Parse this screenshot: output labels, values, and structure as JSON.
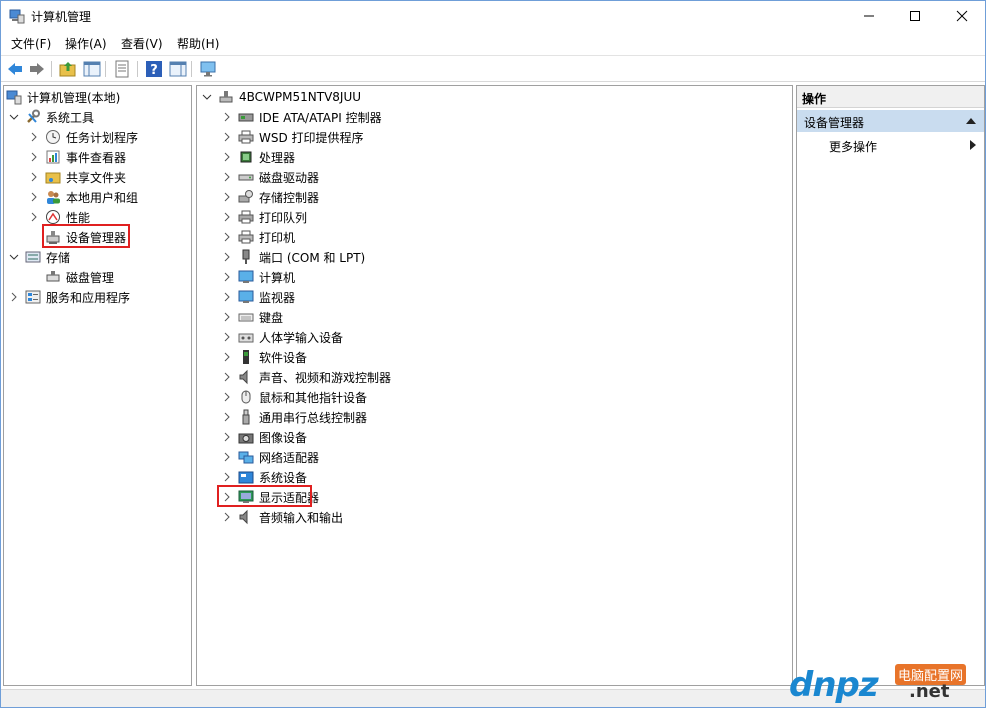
{
  "window": {
    "title": "计算机管理"
  },
  "menu": [
    "文件(F)",
    "操作(A)",
    "查看(V)",
    "帮助(H)"
  ],
  "toolbar": {
    "icons": [
      "back-icon",
      "forward-icon",
      "up-folder-icon",
      "show-hide-tree-icon",
      "export-list-icon",
      "help-icon",
      "show-action-pane-icon",
      "monitor-icon"
    ]
  },
  "tree": {
    "root": "计算机管理(本地)",
    "system_tools": "系统工具",
    "children": [
      {
        "label": "任务计划程序",
        "icon": "clock-icon"
      },
      {
        "label": "事件查看器",
        "icon": "event-viewer-icon"
      },
      {
        "label": "共享文件夹",
        "icon": "shared-folder-icon"
      },
      {
        "label": "本地用户和组",
        "icon": "users-icon"
      },
      {
        "label": "性能",
        "icon": "performance-icon"
      },
      {
        "label": "设备管理器",
        "icon": "device-manager-icon"
      }
    ],
    "storage": "存储",
    "disk_management": "磁盘管理",
    "services": "服务和应用程序"
  },
  "devices": {
    "computer_name": "4BCWPM51NTV8JUU",
    "categories": [
      {
        "label": "IDE ATA/ATAPI 控制器",
        "icon": "ide-controller-icon"
      },
      {
        "label": "WSD 打印提供程序",
        "icon": "printer-icon"
      },
      {
        "label": "处理器",
        "icon": "processor-icon"
      },
      {
        "label": "磁盘驱动器",
        "icon": "disk-drive-icon"
      },
      {
        "label": "存储控制器",
        "icon": "storage-controller-icon"
      },
      {
        "label": "打印队列",
        "icon": "print-queue-icon"
      },
      {
        "label": "打印机",
        "icon": "printer-icon"
      },
      {
        "label": "端口 (COM 和 LPT)",
        "icon": "port-icon"
      },
      {
        "label": "计算机",
        "icon": "computer-icon"
      },
      {
        "label": "监视器",
        "icon": "monitor-icon"
      },
      {
        "label": "键盘",
        "icon": "keyboard-icon"
      },
      {
        "label": "人体学输入设备",
        "icon": "hid-icon"
      },
      {
        "label": "软件设备",
        "icon": "software-device-icon"
      },
      {
        "label": "声音、视频和游戏控制器",
        "icon": "sound-icon"
      },
      {
        "label": "鼠标和其他指针设备",
        "icon": "mouse-icon"
      },
      {
        "label": "通用串行总线控制器",
        "icon": "usb-icon"
      },
      {
        "label": "图像设备",
        "icon": "camera-icon"
      },
      {
        "label": "网络适配器",
        "icon": "network-adapter-icon"
      },
      {
        "label": "系统设备",
        "icon": "system-device-icon"
      },
      {
        "label": "显示适配器",
        "icon": "display-adapter-icon"
      },
      {
        "label": "音频输入和输出",
        "icon": "audio-io-icon"
      }
    ]
  },
  "actions": {
    "header": "操作",
    "section": "设备管理器",
    "more": "更多操作"
  },
  "watermark": {
    "brand": "dnpz",
    "cn": "电脑配置网",
    "net": ".net"
  },
  "colors": {
    "highlight": "#e02020",
    "section_bg": "#c9dcef",
    "brand_blue": "#1a87d0"
  }
}
